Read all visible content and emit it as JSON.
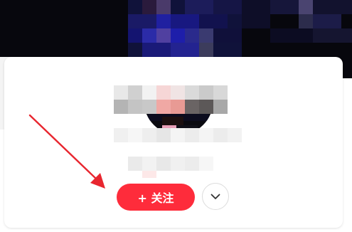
{
  "profile": {
    "follow_label": "+ 关注",
    "follow_icon": "plus-icon",
    "more_icon": "chevron-down-icon"
  },
  "colors": {
    "follow_button": "#fe2c3b",
    "annotation_arrow": "#e8262f",
    "cover_background": "#07070d"
  }
}
